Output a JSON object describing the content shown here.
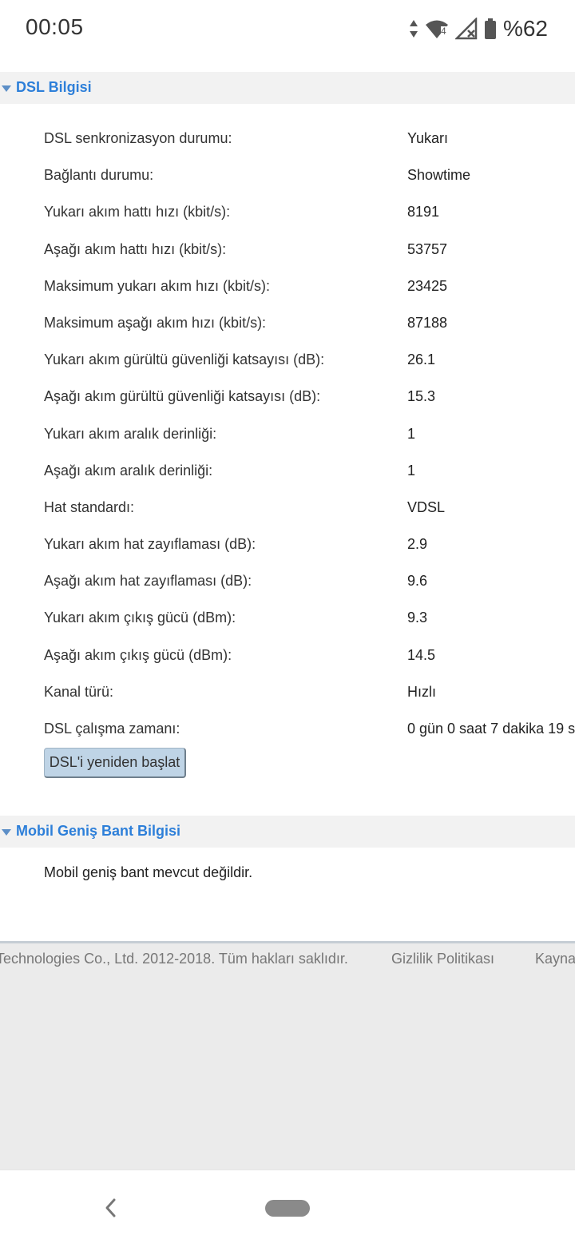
{
  "status_bar": {
    "time": "00:05",
    "battery": "%62",
    "icons": [
      "data-arrows-icon",
      "wifi-icon",
      "signal-icon",
      "battery-icon"
    ],
    "wifi_badge": "4"
  },
  "dsl_section": {
    "title": "DSL Bilgisi",
    "rows": [
      {
        "label": "DSL senkronizasyon durumu:",
        "value": "Yukarı"
      },
      {
        "label": "Bağlantı durumu:",
        "value": "Showtime"
      },
      {
        "label": "Yukarı akım hattı hızı (kbit/s):",
        "value": "8191"
      },
      {
        "label": "Aşağı akım hattı hızı (kbit/s):",
        "value": "53757"
      },
      {
        "label": "Maksimum yukarı akım hızı (kbit/s):",
        "value": "23425"
      },
      {
        "label": "Maksimum aşağı akım hızı (kbit/s):",
        "value": "87188"
      },
      {
        "label": "Yukarı akım gürültü güvenliği katsayısı (dB):",
        "value": "26.1"
      },
      {
        "label": "Aşağı akım gürültü güvenliği katsayısı (dB):",
        "value": "15.3"
      },
      {
        "label": "Yukarı akım aralık derinliği:",
        "value": "1"
      },
      {
        "label": "Aşağı akım aralık derinliği:",
        "value": "1"
      },
      {
        "label": "Hat standardı:",
        "value": "VDSL"
      },
      {
        "label": "Yukarı akım hat zayıflaması (dB):",
        "value": "2.9"
      },
      {
        "label": "Aşağı akım hat zayıflaması (dB):",
        "value": "9.6"
      },
      {
        "label": "Yukarı akım çıkış gücü (dBm):",
        "value": "9.3"
      },
      {
        "label": "Aşağı akım çıkış gücü (dBm):",
        "value": "14.5"
      },
      {
        "label": "Kanal türü:",
        "value": "Hızlı"
      },
      {
        "label": "DSL çalışma zamanı:",
        "value": "0 gün 0 saat 7 dakika 19 s"
      }
    ],
    "restart_button": "DSL'i yeniden başlat"
  },
  "mobile_section": {
    "title": "Mobil Geniş Bant Bilgisi",
    "message": "Mobil geniş bant mevcut değildir."
  },
  "footer": {
    "copyright": "Technologies Co., Ltd. 2012-2018. Tüm hakları saklıdır.",
    "privacy": "Gizlilik Politikası",
    "source": "Kayna"
  },
  "colors": {
    "section_title": "#2d7fd9",
    "section_bg": "#f2f2f2",
    "button_bg": "#bfd4e6",
    "footer_bg": "#ebebeb"
  }
}
